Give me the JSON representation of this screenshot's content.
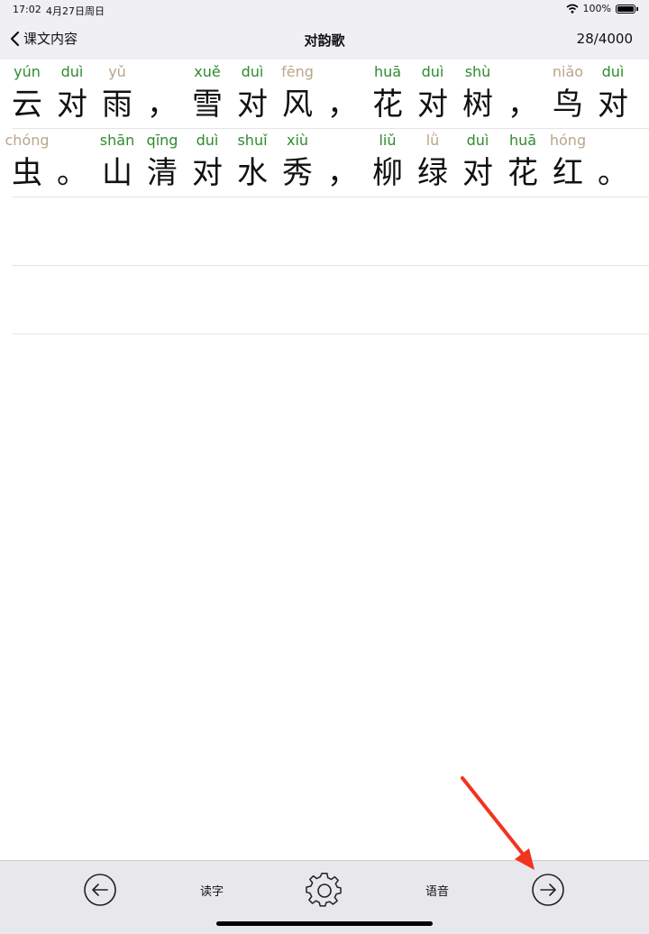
{
  "status": {
    "time": "17:02",
    "date": "4月27日周日",
    "battery": "100%"
  },
  "nav": {
    "back_label": "课文内容",
    "title": "对韵歌",
    "counter": "28/4000"
  },
  "text_rows": [
    [
      {
        "py": "yún",
        "hz": "云",
        "c": "g"
      },
      {
        "py": "duì",
        "hz": "对",
        "c": "g"
      },
      {
        "py": "yǔ",
        "hz": "雨",
        "c": "t"
      },
      {
        "py": "",
        "hz": "，",
        "c": "g"
      },
      {
        "py": "xuě",
        "hz": "雪",
        "c": "g"
      },
      {
        "py": "duì",
        "hz": "对",
        "c": "g"
      },
      {
        "py": "fēng",
        "hz": "风",
        "c": "t"
      },
      {
        "py": "",
        "hz": "，",
        "c": "g"
      },
      {
        "py": "huā",
        "hz": "花",
        "c": "g"
      },
      {
        "py": "duì",
        "hz": "对",
        "c": "g"
      },
      {
        "py": "shù",
        "hz": "树",
        "c": "g"
      },
      {
        "py": "",
        "hz": "，",
        "c": "g"
      },
      {
        "py": "niǎo",
        "hz": "鸟",
        "c": "t"
      },
      {
        "py": "duì",
        "hz": "对",
        "c": "g"
      }
    ],
    [
      {
        "py": "chóng",
        "hz": "虫",
        "c": "t"
      },
      {
        "py": "",
        "hz": "。",
        "c": "g"
      },
      {
        "py": "shān",
        "hz": "山",
        "c": "g"
      },
      {
        "py": "qīng",
        "hz": "清",
        "c": "g"
      },
      {
        "py": "duì",
        "hz": "对",
        "c": "g"
      },
      {
        "py": "shuǐ",
        "hz": "水",
        "c": "g"
      },
      {
        "py": "xiù",
        "hz": "秀",
        "c": "g"
      },
      {
        "py": "",
        "hz": "，",
        "c": "g"
      },
      {
        "py": "liǔ",
        "hz": "柳",
        "c": "g"
      },
      {
        "py": "lǜ",
        "hz": "绿",
        "c": "t"
      },
      {
        "py": "duì",
        "hz": "对",
        "c": "g"
      },
      {
        "py": "huā",
        "hz": "花",
        "c": "g"
      },
      {
        "py": "hóng",
        "hz": "红",
        "c": "t"
      },
      {
        "py": "",
        "hz": "。",
        "c": "g"
      }
    ]
  ],
  "toolbar": {
    "read_label": "读字",
    "voice_label": "语音"
  }
}
